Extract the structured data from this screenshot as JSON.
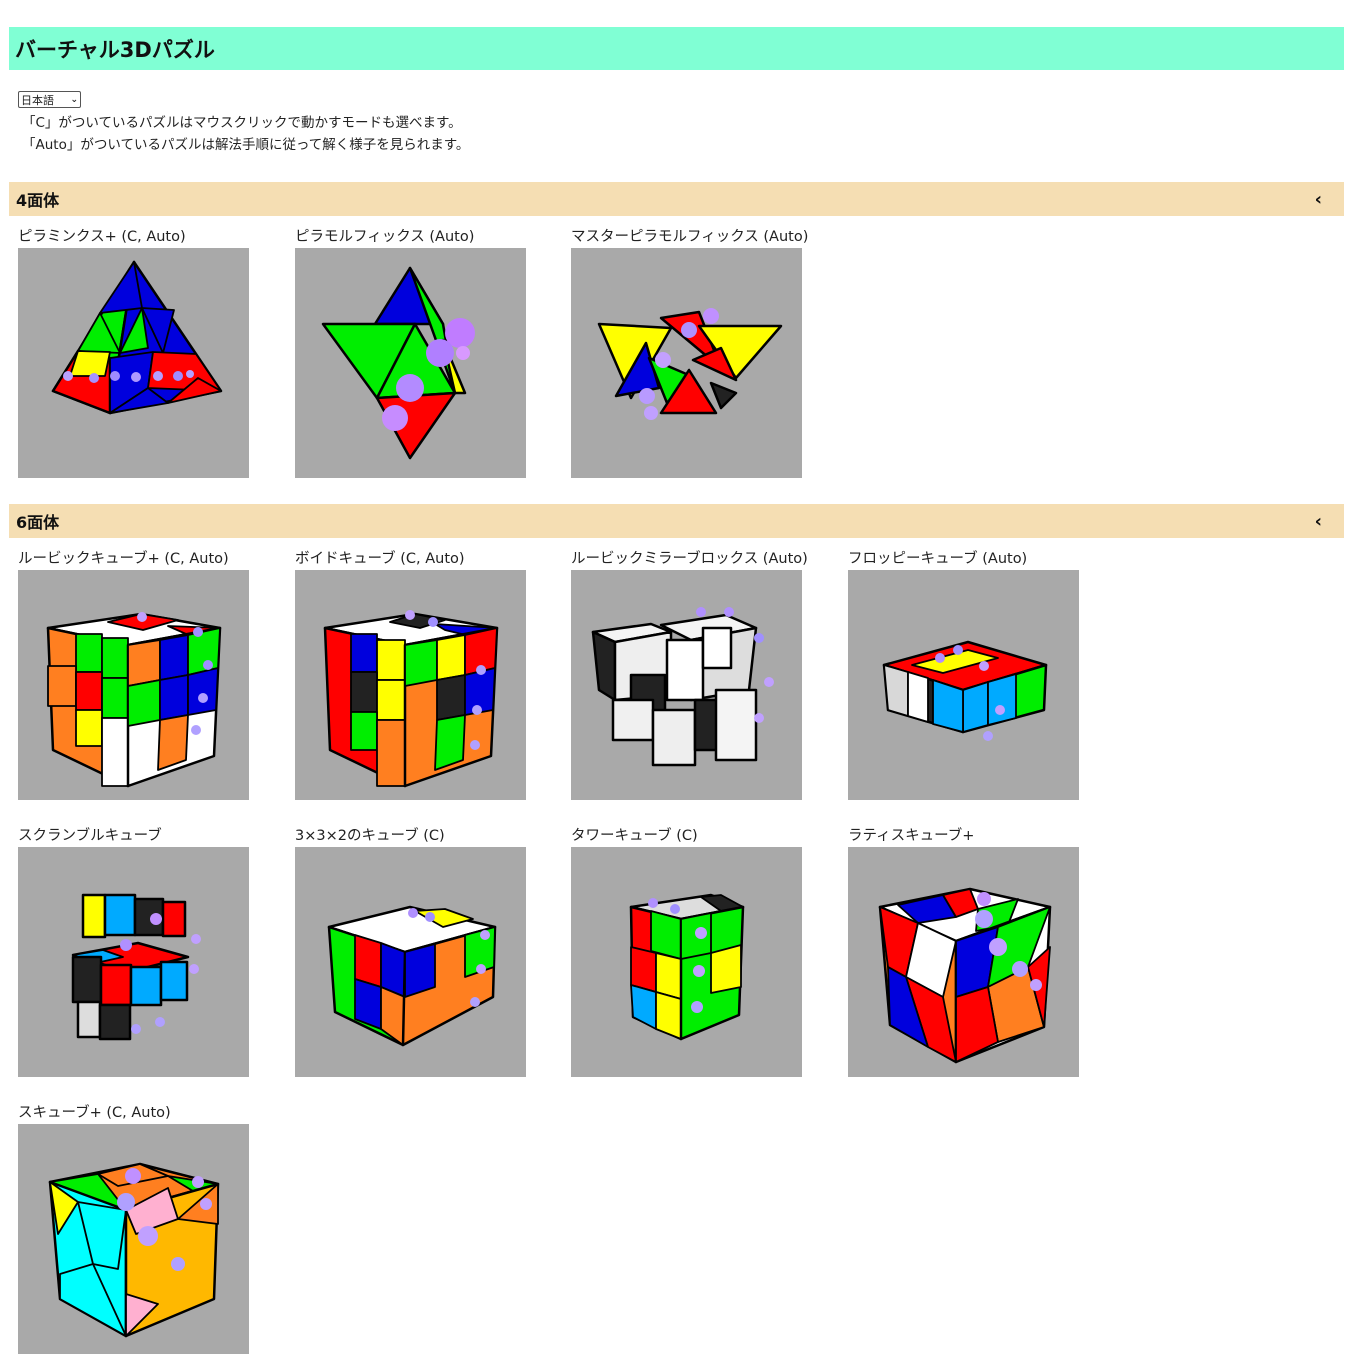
{
  "header": {
    "title": "バーチャル3Dパズル"
  },
  "language": {
    "selected": "日本語"
  },
  "intro": {
    "line1": "「C」がついているパズルはマウスクリックで動かすモードも選べます。",
    "line2": "「Auto」がついているパズルは解法手順に従って解く様子を見られます。"
  },
  "sections": [
    {
      "title": "4面体",
      "toggle_icon": "chevron-left",
      "puzzles": [
        {
          "label": "ピラミンクス+ (C, Auto)"
        },
        {
          "label": "ピラモルフィックス (Auto)"
        },
        {
          "label": "マスターピラモルフィックス (Auto)"
        }
      ]
    },
    {
      "title": "6面体",
      "toggle_icon": "chevron-left",
      "puzzles": [
        {
          "label": "ルービックキューブ+ (C, Auto)"
        },
        {
          "label": "ボイドキューブ (C, Auto)"
        },
        {
          "label": "ルービックミラーブロックス (Auto)"
        },
        {
          "label": "フロッピーキューブ (Auto)"
        },
        {
          "label": "スクランブルキューブ"
        },
        {
          "label": "3×3×2のキューブ (C)"
        },
        {
          "label": "タワーキューブ (C)"
        },
        {
          "label": "ラティスキューブ+"
        },
        {
          "label": "スキューブ+ (C, Auto)"
        }
      ]
    }
  ],
  "colors": {
    "title_bar": "#80ffd4",
    "section_bar": "#f5deb3",
    "thumbnail_bg": "#a9a9a9"
  }
}
